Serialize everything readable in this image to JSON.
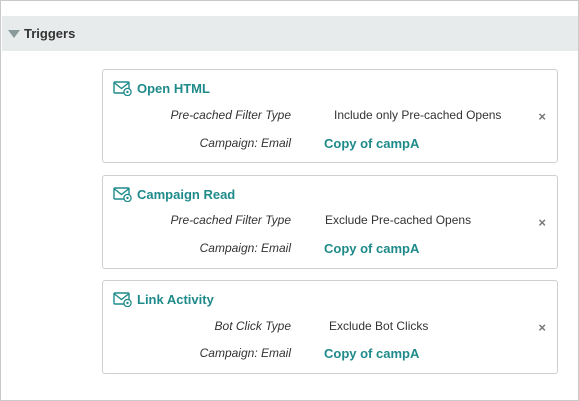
{
  "section": {
    "title": "Triggers"
  },
  "triggers": [
    {
      "title": "Open HTML",
      "row1_label": "Pre-cached Filter Type",
      "row1_value": "Include only Pre-cached Opens",
      "row2_label": "Campaign: Email",
      "row2_value": "Copy of campA",
      "icon": "email-trigger-icon",
      "remove_symbol": "×"
    },
    {
      "title": "Campaign Read",
      "row1_label": "Pre-cached Filter Type",
      "row1_value": "Exclude Pre-cached Opens",
      "row2_label": "Campaign: Email",
      "row2_value": "Copy of campA",
      "icon": "email-trigger-icon",
      "remove_symbol": "×"
    },
    {
      "title": "Link Activity",
      "row1_label": "Bot Click Type",
      "row1_value": "Exclude Bot Clicks",
      "row2_label": "Campaign: Email",
      "row2_value": "Copy of campA",
      "icon": "email-trigger-icon",
      "remove_symbol": "×"
    }
  ],
  "colors": {
    "accent": "#1f8a8a",
    "header_bg": "#e8ebeb",
    "border": "#cfcfcf"
  }
}
